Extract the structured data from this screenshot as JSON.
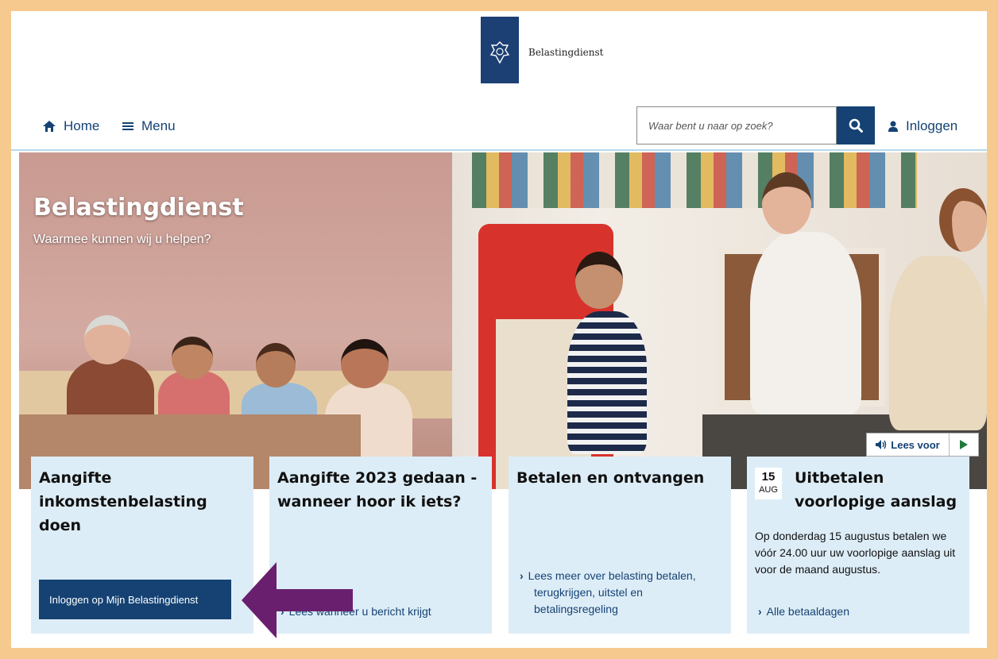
{
  "header": {
    "logo_text": "Belastingdienst",
    "nav": {
      "home_label": "Home",
      "menu_label": "Menu",
      "login_label": "Inloggen"
    },
    "search": {
      "placeholder": "Waar bent u naar op zoek?"
    }
  },
  "hero": {
    "title": "Belastingdienst",
    "subtitle": "Waarmee kunnen wij u helpen?",
    "lees_voor_label": "Lees voor"
  },
  "cards": [
    {
      "title": "Aangifte inkomstenbelasting doen",
      "button_label": "Inloggen op Mijn Belastingdienst"
    },
    {
      "title": "Aangifte 2023 gedaan - wanneer hoor ik iets?",
      "link_label": "Lees wanneer u bericht krijgt"
    },
    {
      "title": "Betalen en ontvangen",
      "link_label": "Lees meer over belasting betalen, terugkrijgen, uitstel en betalingsregeling"
    },
    {
      "date_day": "15",
      "date_month": "AUG",
      "title": "Uitbetalen voorlopige aanslag",
      "text": "Op donderdag 15 augustus betalen we vóór 24.00 uur uw voorlopige aanslag uit voor de maand augustus.",
      "link_label": "Alle betaaldagen"
    }
  ],
  "colors": {
    "brand_blue": "#154273",
    "card_bg": "#ddedf7",
    "frame_border": "#f6c98e",
    "annotation_arrow": "#6a1f6e"
  }
}
